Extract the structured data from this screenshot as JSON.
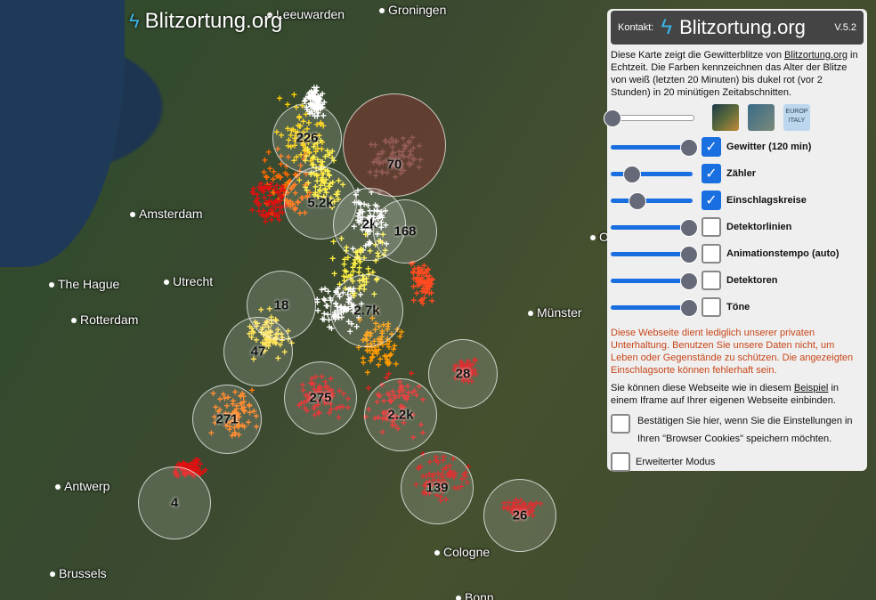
{
  "map": {
    "logo_text": "Blitzortung.org",
    "cities": [
      {
        "name": "Leeuwarden"
      },
      {
        "name": "Groningen"
      },
      {
        "name": "Amsterdam"
      },
      {
        "name": "The Hague"
      },
      {
        "name": "Utrecht"
      },
      {
        "name": "Rotterdam"
      },
      {
        "name": "Münster"
      },
      {
        "name": "Antwerp"
      },
      {
        "name": "Brussels"
      },
      {
        "name": "Cologne"
      },
      {
        "name": "Bonn"
      },
      {
        "name": "O"
      }
    ],
    "clusters": [
      "226",
      "70",
      "5.2k",
      "2k",
      "168",
      "18",
      "2.7k",
      "47",
      "28",
      "275",
      "2.2k",
      "271",
      "139",
      "4",
      "26"
    ]
  },
  "panel": {
    "contact": "Kontakt:",
    "title": "Blitzortung.org",
    "version": "V.5.2",
    "intro_1": "Diese Karte zeigt die Gewitterblitze von ",
    "intro_link": "Blitzortung.org",
    "intro_2": " in Echtzeit. Die Farben kennzeichnen das Alter der Blitze von weiß (letzten 20 Minuten) bis dukel rot (vor 2 Stunden) in 20 minütigen Zeitabschnitten.",
    "thumb_label": "EUROP ITALY",
    "options": [
      {
        "label": "Gewitter",
        "suffix": "(120 min)",
        "checked": true,
        "slider": 0.95
      },
      {
        "label": "Zähler",
        "suffix": "",
        "checked": true,
        "slider": 0.25
      },
      {
        "label": "Einschlagskreise",
        "suffix": "",
        "checked": true,
        "slider": 0.32
      },
      {
        "label": "Detektorlinien",
        "suffix": "",
        "checked": false,
        "slider": 0.95
      },
      {
        "label": "Animationstempo",
        "suffix": "(auto)",
        "checked": false,
        "slider": 0.95
      },
      {
        "label": "Detektoren",
        "suffix": "",
        "checked": false,
        "slider": 0.95
      },
      {
        "label": "Töne",
        "suffix": "",
        "checked": false,
        "slider": 0.95
      }
    ],
    "opacity_slider": 0.0,
    "warning": "Diese Webseite dient lediglich unserer privaten Unterhaltung. Benutzen Sie unsere Daten nicht, um Leben oder Gegenstände zu schützen. Die angezeigten Einschlagsorte können fehlerhaft sein.",
    "embed_1": "Sie können diese Webseite wie in diesem ",
    "embed_link": "Beispiel",
    "embed_2": " in einem Iframe auf Ihrer eigenen Webseite einbinden.",
    "cookie_label": "Bestätigen Sie hier, wenn Sie die Einstellungen in Ihren \"Browser Cookies\" speichern möchten.",
    "extended_label": "Erweiterter Modus"
  }
}
